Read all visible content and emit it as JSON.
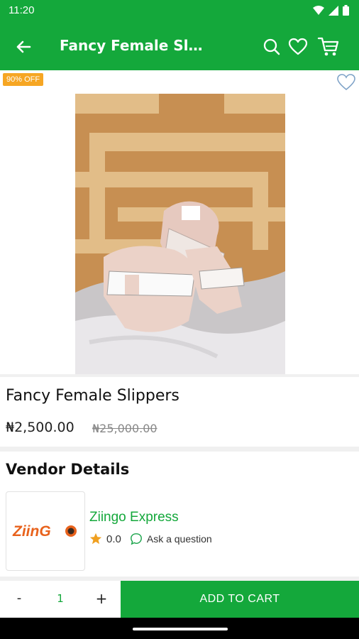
{
  "status_bar": {
    "time": "11:20"
  },
  "app_bar": {
    "title": "Fancy Female Slippers"
  },
  "product": {
    "discount_badge": "90% OFF",
    "name": "Fancy Female Slippers",
    "price": "₦2,500.00",
    "old_price": "₦25,000.00"
  },
  "vendor": {
    "heading": "Vendor Details",
    "logo_text_main": "ZiinG",
    "name": "Ziingo Express",
    "rating": "0.0",
    "ask_label": "Ask a question"
  },
  "cart": {
    "minus_label": "-",
    "quantity": "1",
    "plus_label": "+",
    "add_label": "ADD TO CART"
  },
  "colors": {
    "primary": "#14a83b",
    "badge": "#f6a623",
    "star": "#f0a020",
    "logo_orange": "#e8621c"
  }
}
